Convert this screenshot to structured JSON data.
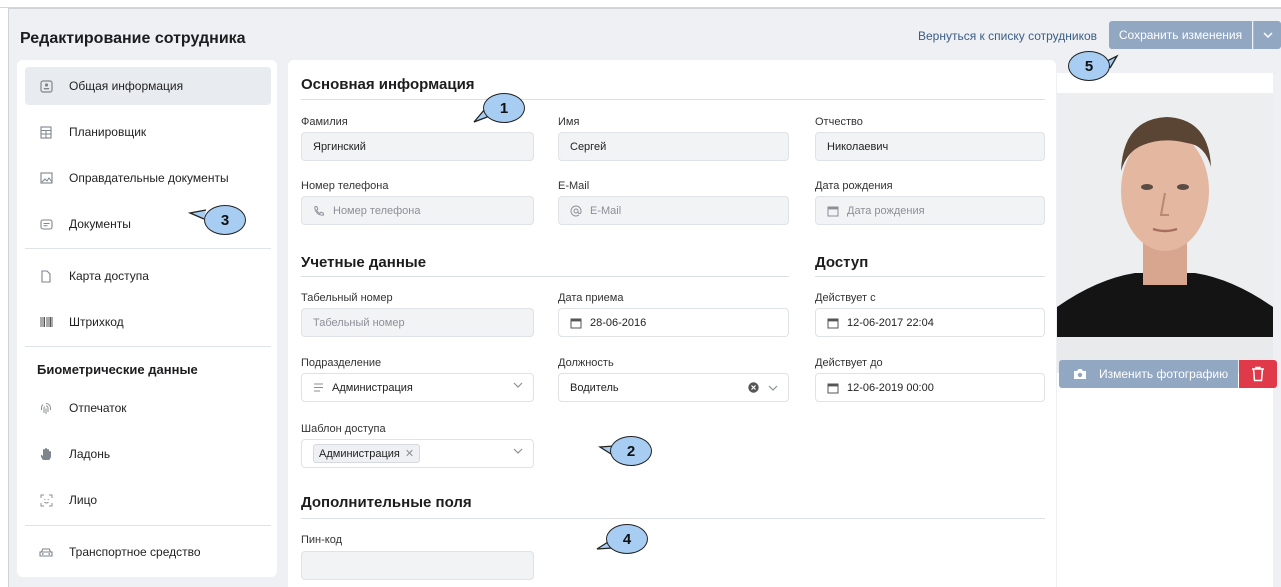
{
  "header": {
    "title": "Редактирование сотрудника",
    "back_link": "Вернуться к списку сотрудников",
    "save_label": "Сохранить изменения"
  },
  "sidebar": {
    "items": [
      {
        "label": "Общая информация",
        "icon": "id-card-icon"
      },
      {
        "label": "Планировщик",
        "icon": "calendar-grid-icon"
      },
      {
        "label": "Оправдательные документы",
        "icon": "image-doc-icon"
      },
      {
        "label": "Документы",
        "icon": "passport-icon"
      },
      {
        "label": "Карта доступа",
        "icon": "card-icon"
      },
      {
        "label": "Штрихкод",
        "icon": "barcode-icon"
      },
      {
        "label": "Отпечаток",
        "icon": "fingerprint-icon"
      },
      {
        "label": "Ладонь",
        "icon": "palm-icon"
      },
      {
        "label": "Лицо",
        "icon": "face-scan-icon"
      },
      {
        "label": "Транспортное средство",
        "icon": "car-icon"
      }
    ],
    "biometric_heading": "Биометрические данные"
  },
  "main": {
    "basic": {
      "title": "Основная информация",
      "last_name_label": "Фамилия",
      "last_name_value": "Яргинский",
      "first_name_label": "Имя",
      "first_name_value": "Сергей",
      "middle_name_label": "Отчество",
      "middle_name_value": "Николаевич",
      "phone_label": "Номер телефона",
      "phone_placeholder": "Номер телефона",
      "email_label": "E-Mail",
      "email_placeholder": "E-Mail",
      "birth_label": "Дата рождения",
      "birth_placeholder": "Дата рождения"
    },
    "account": {
      "title": "Учетные данные",
      "tab_label": "Табельный номер",
      "tab_placeholder": "Табельный номер",
      "hire_label": "Дата приема",
      "hire_value": "28-06-2016",
      "dept_label": "Подразделение",
      "dept_value": "Администрация",
      "position_label": "Должность",
      "position_value": "Водитель",
      "template_label": "Шаблон доступа",
      "template_chip": "Администрация"
    },
    "access": {
      "title": "Доступ",
      "from_label": "Действует с",
      "from_value": "12-06-2017 22:04",
      "to_label": "Действует до",
      "to_value": "12-06-2019 00:00"
    },
    "extra": {
      "title": "Дополнительные поля",
      "pin_label": "Пин-код",
      "pin_value": ""
    }
  },
  "photo": {
    "change_label": "Изменить фотографию"
  },
  "callouts": [
    "1",
    "2",
    "3",
    "4",
    "5"
  ],
  "colors": {
    "accent_button": "#91a7c2",
    "delete_button": "#e0394a",
    "callout_fill": "#a7cdf2",
    "link": "#3b5d86"
  }
}
